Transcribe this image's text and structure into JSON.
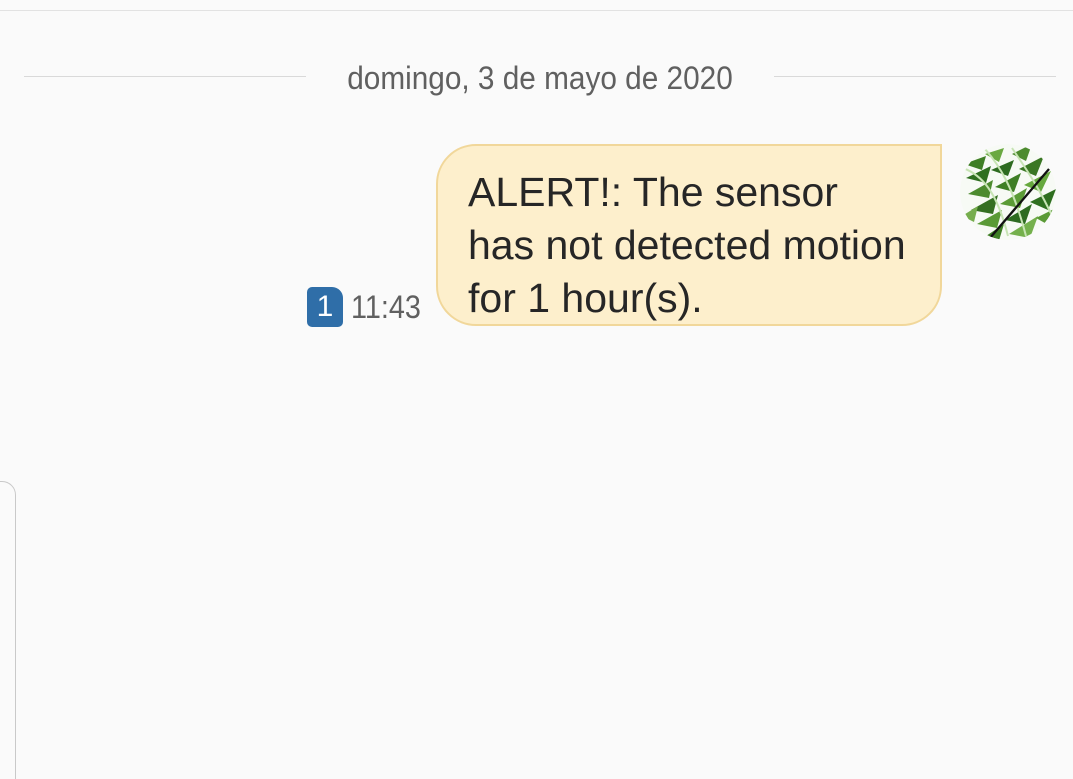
{
  "conversation": {
    "date_separator": "domingo, 3 de mayo de 2020"
  },
  "message": {
    "sim_slot": "1",
    "time": "11:43",
    "text": "ALERT!: The sensor has not detected motion for 1 hour(s).",
    "bubble_color": "#fdefcc",
    "bubble_border_color": "#f1d79a"
  },
  "avatar": {
    "icon": "fern-leaf-avatar"
  },
  "colors": {
    "background": "#fafafa",
    "sim_badge": "#2f6ea8",
    "secondary_text": "#606060"
  }
}
